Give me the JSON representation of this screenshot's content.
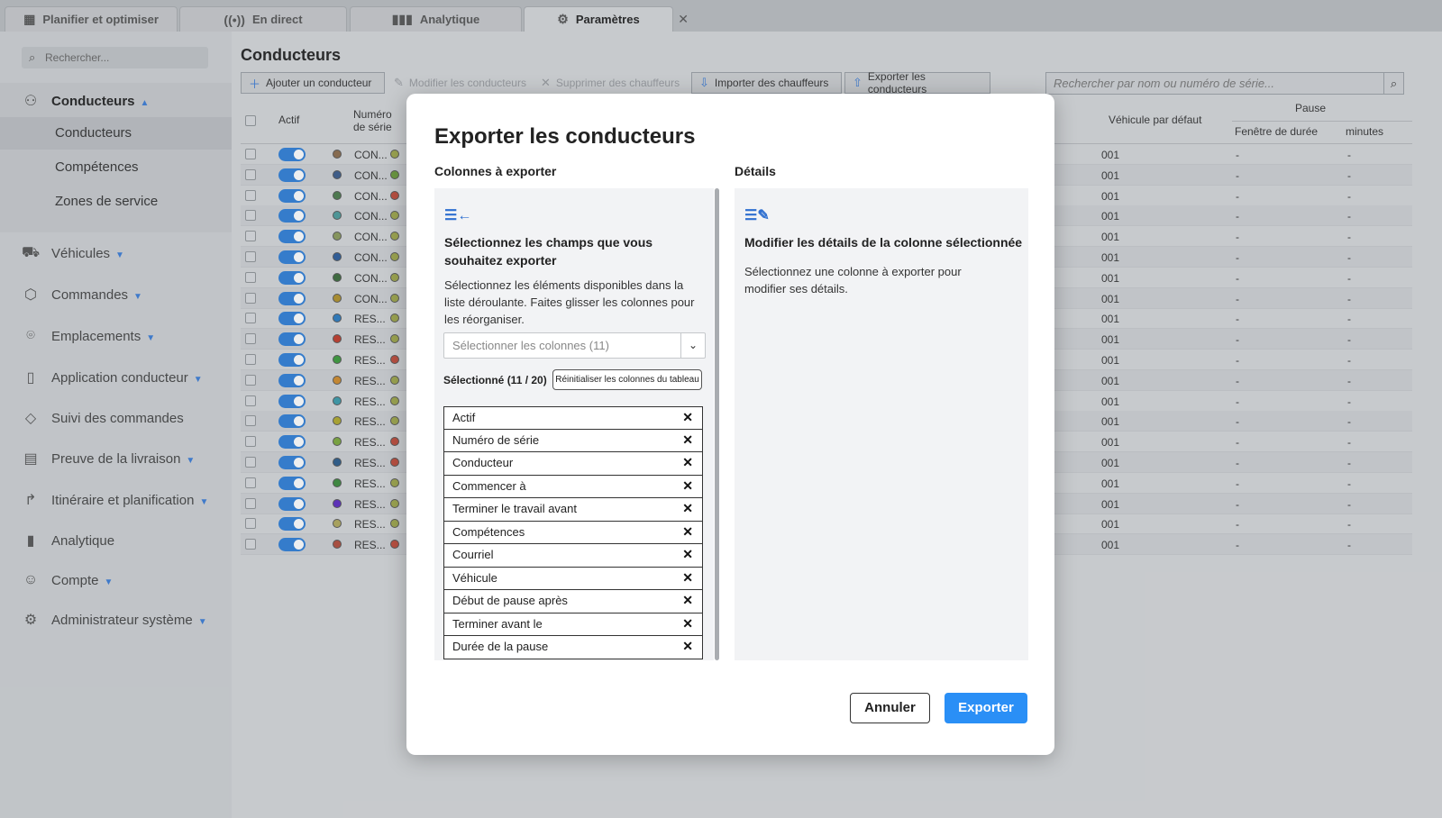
{
  "tabs": [
    {
      "label": "Planifier et optimiser",
      "icon": "calendar-icon"
    },
    {
      "label": "En direct",
      "icon": "broadcast-icon"
    },
    {
      "label": "Analytique",
      "icon": "bar-chart-icon"
    },
    {
      "label": "Paramètres",
      "icon": "gear-icon",
      "active": true
    }
  ],
  "sidebar": {
    "search_placeholder": "Rechercher...",
    "drivers_group": {
      "label": "Conducteurs",
      "sub": [
        "Conducteurs",
        "Compétences",
        "Zones de service"
      ],
      "selected": "Conducteurs"
    },
    "items": [
      {
        "label": "Véhicules",
        "icon": "truck-icon",
        "caret": true
      },
      {
        "label": "Commandes",
        "icon": "box-icon",
        "caret": true
      },
      {
        "label": "Emplacements",
        "icon": "pin-icon",
        "caret": true
      },
      {
        "label": "Application conducteur",
        "icon": "phone-icon",
        "caret": true
      },
      {
        "label": "Suivi des commandes",
        "icon": "tag-icon",
        "caret": false
      },
      {
        "label": "Preuve de la livraison",
        "icon": "clipboard-icon",
        "caret": true
      },
      {
        "label": "Itinéraire et planification",
        "icon": "route-icon",
        "caret": true
      },
      {
        "label": "Analytique",
        "icon": "bar-chart-icon",
        "caret": false
      },
      {
        "label": "Compte",
        "icon": "user-icon",
        "caret": true
      },
      {
        "label": "Administrateur système",
        "icon": "gear-icon",
        "caret": true
      }
    ]
  },
  "main": {
    "title": "Conducteurs",
    "toolbar": {
      "add": "Ajouter un conducteur",
      "edit": "Modifier les conducteurs",
      "delete": "Supprimer des chauffeurs",
      "import": "Importer des chauffeurs",
      "export": "Exporter les conducteurs"
    },
    "search_placeholder": "Rechercher par nom ou numéro de série...",
    "grid": {
      "headers": {
        "active": "Actif",
        "serial": "Numéro de série",
        "vehicle": "Véhicule par défaut",
        "pause": "Pause",
        "pause_window": "Fenêtre de durée",
        "minutes": "minutes"
      },
      "rows": [
        {
          "code": "CON...",
          "dot": "#8a6a4a",
          "dot2": "#a0a84a",
          "vehicle": "001",
          "window": "-",
          "minutes": "-"
        },
        {
          "code": "CON...",
          "dot": "#3a5a8a",
          "dot2": "#6a9a3a",
          "vehicle": "001",
          "window": "-",
          "minutes": "-"
        },
        {
          "code": "CON...",
          "dot": "#4a7a4a",
          "dot2": "#c04a3a",
          "vehicle": "001",
          "window": "-",
          "minutes": "-"
        },
        {
          "code": "CON...",
          "dot": "#4a9a9a",
          "dot2": "#a0a84a",
          "vehicle": "001",
          "window": "-",
          "minutes": "-"
        },
        {
          "code": "CON...",
          "dot": "#8a9a5a",
          "dot2": "#a0a84a",
          "vehicle": "001",
          "window": "-",
          "minutes": "-"
        },
        {
          "code": "CON...",
          "dot": "#2a5a9a",
          "dot2": "#a0a84a",
          "vehicle": "001",
          "window": "-",
          "minutes": "-"
        },
        {
          "code": "CON...",
          "dot": "#3a6a3a",
          "dot2": "#a0a84a",
          "vehicle": "001",
          "window": "-",
          "minutes": "-"
        },
        {
          "code": "CON...",
          "dot": "#b0902a",
          "dot2": "#a0a84a",
          "vehicle": "001",
          "window": "-",
          "minutes": "-"
        },
        {
          "code": "RES...",
          "dot": "#2a7ac0",
          "dot2": "#a0a84a",
          "vehicle": "001",
          "window": "-",
          "minutes": "-"
        },
        {
          "code": "RES...",
          "dot": "#c03a2a",
          "dot2": "#a0a84a",
          "vehicle": "001",
          "window": "-",
          "minutes": "-"
        },
        {
          "code": "RES...",
          "dot": "#3a9a3a",
          "dot2": "#c04a3a",
          "vehicle": "001",
          "window": "-",
          "minutes": "-"
        },
        {
          "code": "RES...",
          "dot": "#d08a2a",
          "dot2": "#a0a84a",
          "vehicle": "001",
          "window": "-",
          "minutes": "-"
        },
        {
          "code": "RES...",
          "dot": "#3a9aaa",
          "dot2": "#a0a84a",
          "vehicle": "001",
          "window": "-",
          "minutes": "-"
        },
        {
          "code": "RES...",
          "dot": "#b0a82a",
          "dot2": "#a0a84a",
          "vehicle": "001",
          "window": "-",
          "minutes": "-"
        },
        {
          "code": "RES...",
          "dot": "#7aa83a",
          "dot2": "#c04a3a",
          "vehicle": "001",
          "window": "-",
          "minutes": "-"
        },
        {
          "code": "RES...",
          "dot": "#2a5a8a",
          "dot2": "#c04a3a",
          "vehicle": "001",
          "window": "-",
          "minutes": "-"
        },
        {
          "code": "RES...",
          "dot": "#3a8a3a",
          "dot2": "#a0a84a",
          "vehicle": "001",
          "window": "-",
          "minutes": "-"
        },
        {
          "code": "RES...",
          "dot": "#5a2ac0",
          "dot2": "#a0a84a",
          "vehicle": "001",
          "window": "-",
          "minutes": "-"
        },
        {
          "code": "RES...",
          "dot": "#b0a85a",
          "dot2": "#a0a84a",
          "vehicle": "001",
          "window": "-",
          "minutes": "-"
        },
        {
          "code": "RES...",
          "dot": "#b04a3a",
          "dot2": "#c04a3a",
          "vehicle": "001",
          "window": "-",
          "minutes": "-"
        }
      ]
    }
  },
  "modal": {
    "title": "Exporter les conducteurs",
    "columns_heading": "Colonnes à exporter",
    "details_heading": "Détails",
    "left": {
      "heading": "Sélectionnez les champs que vous souhaitez exporter",
      "text": "Sélectionnez les éléments disponibles dans la liste déroulante. Faites glisser les colonnes pour les réorganiser.",
      "select_placeholder": "Sélectionner les colonnes (11)",
      "selected_count": "Sélectionné (11 / 20)",
      "reset_label": "Réinitialiser les colonnes du tableau",
      "columns": [
        "Actif",
        "Numéro de série",
        "Conducteur",
        "Commencer à",
        "Terminer le travail avant",
        "Compétences",
        "Courriel",
        "Véhicule",
        "Début de pause après",
        "Terminer avant le",
        "Durée de la pause"
      ]
    },
    "right": {
      "heading": "Modifier les détails de la colonne sélectionnée",
      "text": "Sélectionnez une colonne à exporter pour modifier ses détails."
    },
    "cancel": "Annuler",
    "export": "Exporter",
    "accent": "#2a8ff6"
  }
}
